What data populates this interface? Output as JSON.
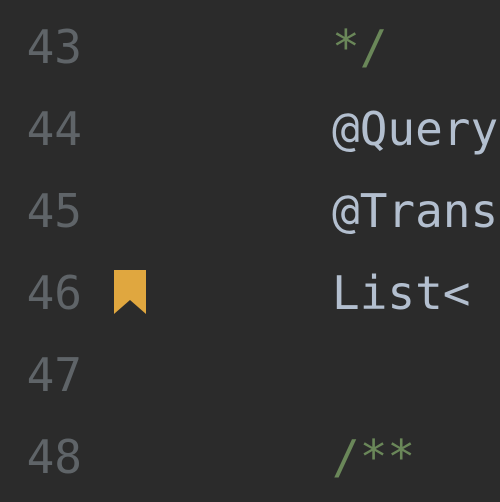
{
  "colors": {
    "background": "#2b2b2b",
    "lineNumber": "#5f6468",
    "code": "#b3bfcf",
    "comment": "#6a8759",
    "bookmark": "#e0a73f"
  },
  "lines": [
    {
      "number": "43",
      "bookmarked": false,
      "tokens": [
        {
          "kind": "comment",
          "text": "*/"
        }
      ]
    },
    {
      "number": "44",
      "bookmarked": false,
      "tokens": [
        {
          "kind": "annot",
          "text": "@Query"
        }
      ]
    },
    {
      "number": "45",
      "bookmarked": false,
      "tokens": [
        {
          "kind": "annot",
          "text": "@Trans"
        }
      ]
    },
    {
      "number": "46",
      "bookmarked": true,
      "tokens": [
        {
          "kind": "ident",
          "text": "List<"
        }
      ]
    },
    {
      "number": "47",
      "bookmarked": false,
      "tokens": []
    },
    {
      "number": "48",
      "bookmarked": false,
      "tokens": [
        {
          "kind": "comment",
          "text": "/**"
        }
      ]
    }
  ]
}
